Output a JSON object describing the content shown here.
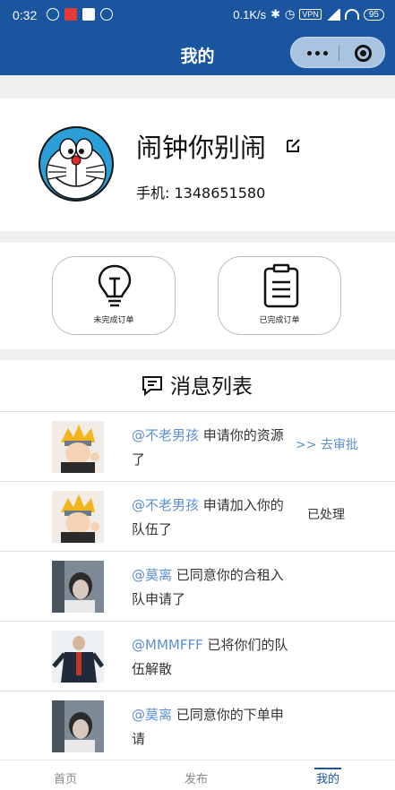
{
  "status_bar": {
    "time": "0:32",
    "network_speed": "0.1K/s",
    "vpn": "VPN",
    "battery": "95"
  },
  "nav": {
    "title": "我的"
  },
  "profile": {
    "username": "闹钟你别闹",
    "phone": "手机: 1348651580"
  },
  "orders": [
    {
      "label": "未完成订单",
      "icon": "lightbulb-icon"
    },
    {
      "label": "已完成订单",
      "icon": "clipboard-icon"
    }
  ],
  "messages": {
    "title": "消息列表",
    "items": [
      {
        "who": "@不老男孩",
        "text": " 申请你的资源了",
        "action": ">> 去审批",
        "status": ""
      },
      {
        "who": "@不老男孩",
        "text": " 申请加入你的队伍了",
        "action": "",
        "status": "已处理"
      },
      {
        "who": "@莫离",
        "text": " 已同意你的合租入队申请了",
        "action": "",
        "status": ""
      },
      {
        "who": "@MMMFFF",
        "text": " 已将你们的队伍解散",
        "action": "",
        "status": ""
      },
      {
        "who": "@莫离",
        "text": " 已同意你的下单申请",
        "action": "",
        "status": ""
      }
    ]
  },
  "tabbar": {
    "tabs": [
      {
        "label": "首页"
      },
      {
        "label": "发布"
      },
      {
        "label": "我的"
      }
    ],
    "active_color": "#1a56a0"
  },
  "colors": {
    "brand": "#1a56a0",
    "link": "#5b8fd1"
  }
}
